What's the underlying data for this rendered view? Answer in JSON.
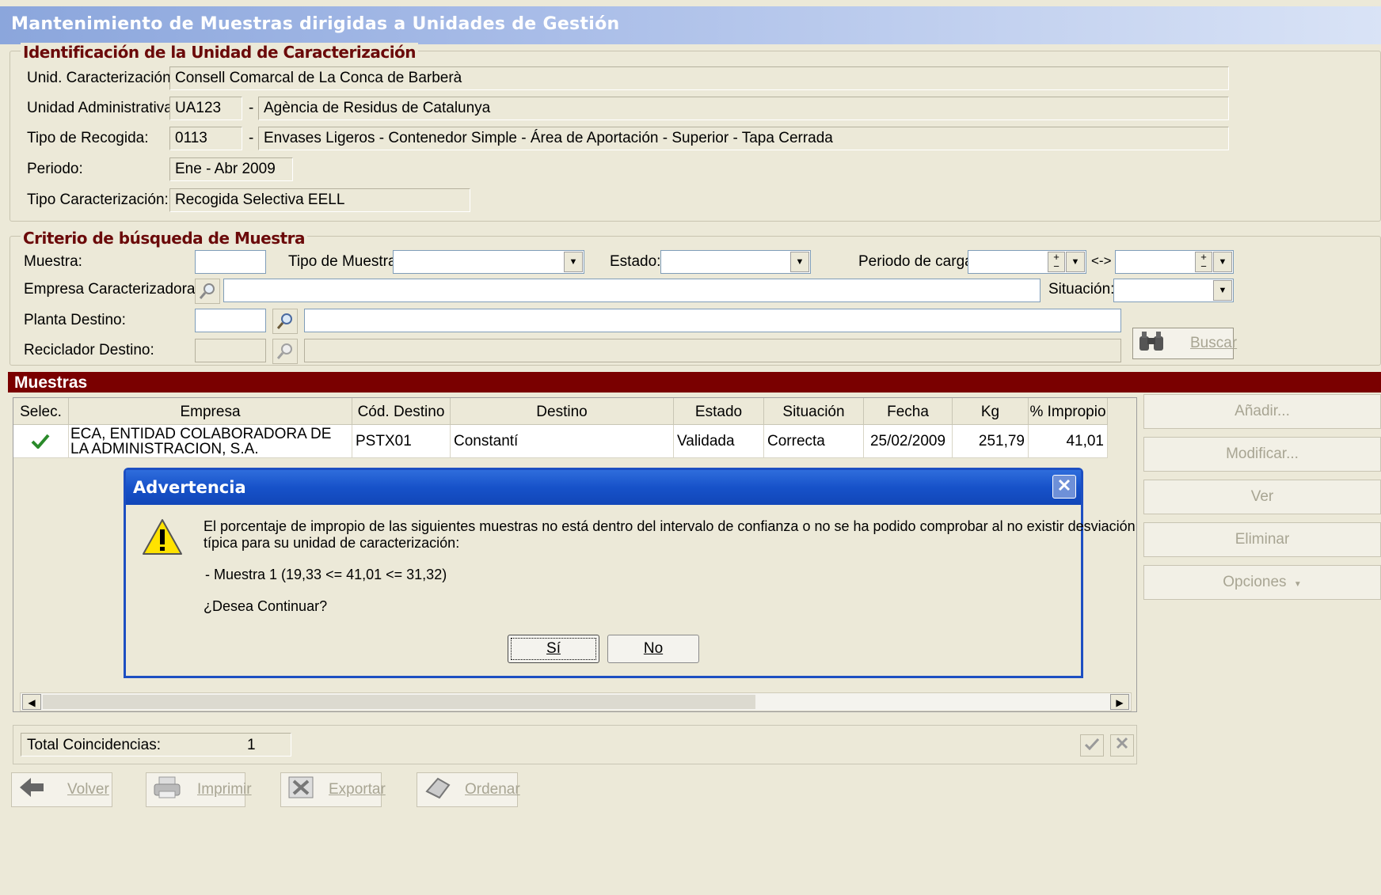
{
  "window": {
    "title": "Mantenimiento de Muestras dirigidas a Unidades de Gestión"
  },
  "identificacion": {
    "legend": "Identificación de la Unidad de Caracterización",
    "unid_caract_label": "Unid. Caracterización:",
    "unid_caract_value": "Consell Comarcal de La Conca de Barberà",
    "unidad_admin_label": "Unidad Administrativa:",
    "unidad_admin_code": "UA123",
    "unidad_admin_desc": "Agència de Residus de Catalunya",
    "tipo_recogida_label": "Tipo de Recogida:",
    "tipo_recogida_code": "0113",
    "tipo_recogida_desc": "Envases Ligeros - Contenedor Simple - Área de Aportación - Superior - Tapa Cerrada",
    "periodo_label": "Periodo:",
    "periodo_value": "Ene - Abr 2009",
    "tipo_caract_label": "Tipo Caracterización:",
    "tipo_caract_value": "Recogida Selectiva EELL",
    "separator": "-"
  },
  "criterio": {
    "legend": "Criterio de búsqueda de Muestra",
    "muestra_label": "Muestra:",
    "tipo_muestra_label": "Tipo de Muestra:",
    "estado_label": "Estado:",
    "periodo_carga_label": "Periodo de carga:",
    "range_sep": "<->",
    "empresa_label": "Empresa Caracterizadora:",
    "situacion_label": "Situación:",
    "planta_label": "Planta Destino:",
    "reciclador_label": "Reciclador Destino:",
    "buscar": "Buscar"
  },
  "muestras": {
    "header": "Muestras",
    "columns": [
      "Selec.",
      "Empresa",
      "Cód. Destino",
      "Destino",
      "Estado",
      "Situación",
      "Fecha",
      "Kg",
      "% Impropio"
    ],
    "rows": [
      {
        "empresa": "ECA, ENTIDAD COLABORADORA DE LA ADMINISTRACION, S.A.",
        "cod_destino": "PSTX01",
        "destino": "Constantí",
        "estado": "Validada",
        "situacion": "Correcta",
        "fecha": "25/02/2009",
        "kg": "251,79",
        "impropio": "41,01"
      }
    ],
    "total_label": "Total Coincidencias:",
    "total_value": "1"
  },
  "side_buttons": {
    "anadir": "Añadir...",
    "modificar": "Modificar...",
    "ver": "Ver",
    "eliminar": "Eliminar",
    "opciones": "Opciones"
  },
  "bottom_buttons": {
    "volver": "Volver",
    "imprimir": "Imprimir",
    "exportar": "Exportar",
    "ordenar": "Ordenar"
  },
  "dialog": {
    "title": "Advertencia",
    "message_line1": "El porcentaje de impropio de las siguientes muestras no está dentro del intervalo de confianza o no se ha podido comprobar al no existir desviación",
    "message_line2": "típica para su unidad de caracterización:",
    "detail": "- Muestra 1 (19,33 <= 41,01 <= 31,32)",
    "question": "¿Desea Continuar?",
    "yes": "Sí",
    "no": "No"
  },
  "colors": {
    "section_legend": "#6b0a0a",
    "muestras_bar": "#7a0000",
    "dialog_title": "#1752c9"
  }
}
